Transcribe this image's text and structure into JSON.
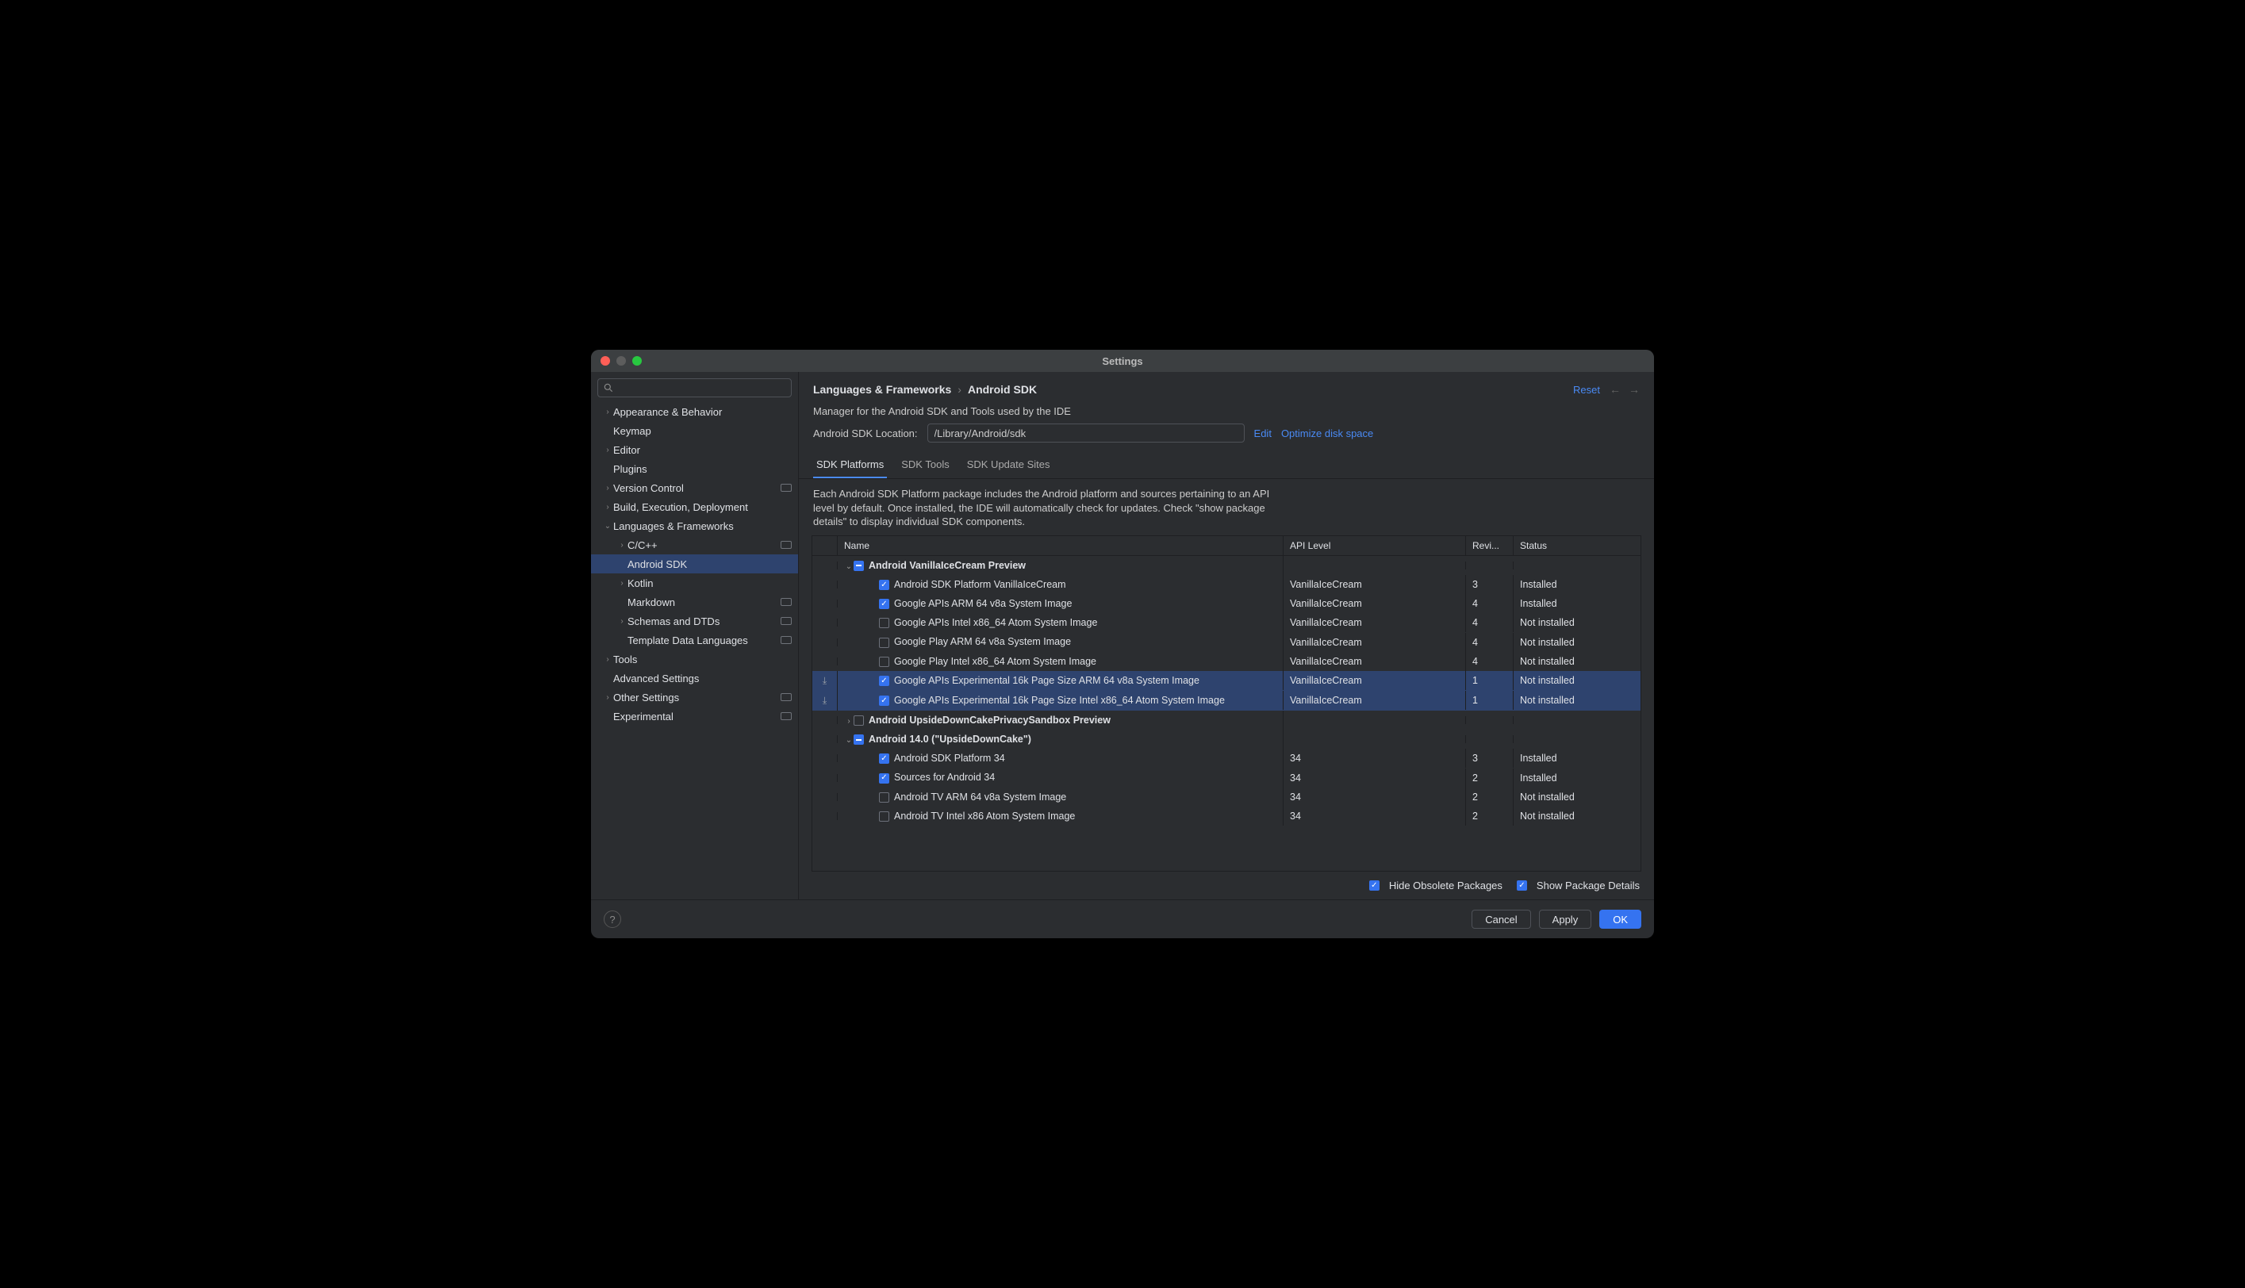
{
  "window": {
    "title": "Settings"
  },
  "search": {
    "placeholder": ""
  },
  "sidebar": {
    "items": [
      {
        "label": "Appearance & Behavior",
        "indent": 0,
        "arrow": "right",
        "pill": false
      },
      {
        "label": "Keymap",
        "indent": 0,
        "arrow": "",
        "pill": false
      },
      {
        "label": "Editor",
        "indent": 0,
        "arrow": "right",
        "pill": false
      },
      {
        "label": "Plugins",
        "indent": 0,
        "arrow": "",
        "pill": false
      },
      {
        "label": "Version Control",
        "indent": 0,
        "arrow": "right",
        "pill": true
      },
      {
        "label": "Build, Execution, Deployment",
        "indent": 0,
        "arrow": "right",
        "pill": false
      },
      {
        "label": "Languages & Frameworks",
        "indent": 0,
        "arrow": "down",
        "pill": false
      },
      {
        "label": "C/C++",
        "indent": 1,
        "arrow": "right",
        "pill": true
      },
      {
        "label": "Android SDK",
        "indent": 1,
        "arrow": "",
        "pill": false,
        "selected": true
      },
      {
        "label": "Kotlin",
        "indent": 1,
        "arrow": "right",
        "pill": false
      },
      {
        "label": "Markdown",
        "indent": 1,
        "arrow": "",
        "pill": true
      },
      {
        "label": "Schemas and DTDs",
        "indent": 1,
        "arrow": "right",
        "pill": true
      },
      {
        "label": "Template Data Languages",
        "indent": 1,
        "arrow": "",
        "pill": true
      },
      {
        "label": "Tools",
        "indent": 0,
        "arrow": "right",
        "pill": false
      },
      {
        "label": "Advanced Settings",
        "indent": 0,
        "arrow": "",
        "pill": false
      },
      {
        "label": "Other Settings",
        "indent": 0,
        "arrow": "right",
        "pill": true
      },
      {
        "label": "Experimental",
        "indent": 0,
        "arrow": "",
        "pill": true
      }
    ]
  },
  "header": {
    "crumb1": "Languages & Frameworks",
    "crumb2": "Android SDK",
    "reset": "Reset"
  },
  "main": {
    "subtitle": "Manager for the Android SDK and Tools used by the IDE",
    "loc_label": "Android SDK Location:",
    "loc_value": "/Library/Android/sdk",
    "edit": "Edit",
    "optimize": "Optimize disk space",
    "tabs": [
      "SDK Platforms",
      "SDK Tools",
      "SDK Update Sites"
    ],
    "desc": "Each Android SDK Platform package includes the Android platform and sources pertaining to an API level by default. Once installed, the IDE will automatically check for updates. Check \"show package details\" to display individual SDK components.",
    "cols": {
      "name": "Name",
      "api": "API Level",
      "rev": "Revi...",
      "status": "Status"
    }
  },
  "rows": [
    {
      "type": "group",
      "expand": "down",
      "chk": "indet",
      "bold": true,
      "name": "Android VanillaIceCream Preview"
    },
    {
      "type": "item",
      "chk": "checked",
      "name": "Android SDK Platform VanillaIceCream",
      "api": "VanillaIceCream",
      "rev": "3",
      "status": "Installed"
    },
    {
      "type": "item",
      "chk": "checked",
      "name": "Google APIs ARM 64 v8a System Image",
      "api": "VanillaIceCream",
      "rev": "4",
      "status": "Installed"
    },
    {
      "type": "item",
      "chk": "",
      "name": "Google APIs Intel x86_64 Atom System Image",
      "api": "VanillaIceCream",
      "rev": "4",
      "status": "Not installed"
    },
    {
      "type": "item",
      "chk": "",
      "name": "Google Play ARM 64 v8a System Image",
      "api": "VanillaIceCream",
      "rev": "4",
      "status": "Not installed"
    },
    {
      "type": "item",
      "chk": "",
      "name": "Google Play Intel x86_64 Atom System Image",
      "api": "VanillaIceCream",
      "rev": "4",
      "status": "Not installed"
    },
    {
      "type": "item",
      "sel": true,
      "dl": true,
      "chk": "checked",
      "name": "Google APIs Experimental 16k Page Size ARM 64 v8a System Image",
      "api": "VanillaIceCream",
      "rev": "1",
      "status": "Not installed"
    },
    {
      "type": "item",
      "sel": true,
      "dl": true,
      "chk": "checked",
      "name": "Google APIs Experimental 16k Page Size Intel x86_64 Atom System Image",
      "api": "VanillaIceCream",
      "rev": "1",
      "status": "Not installed"
    },
    {
      "type": "group",
      "expand": "right",
      "chk": "",
      "bold": true,
      "name": "Android UpsideDownCakePrivacySandbox Preview"
    },
    {
      "type": "group",
      "expand": "down",
      "chk": "indet",
      "bold": true,
      "name": "Android 14.0 (\"UpsideDownCake\")"
    },
    {
      "type": "item",
      "chk": "checked",
      "name": "Android SDK Platform 34",
      "api": "34",
      "rev": "3",
      "status": "Installed"
    },
    {
      "type": "item",
      "chk": "checked",
      "name": "Sources for Android 34",
      "api": "34",
      "rev": "2",
      "status": "Installed"
    },
    {
      "type": "item",
      "chk": "",
      "name": "Android TV ARM 64 v8a System Image",
      "api": "34",
      "rev": "2",
      "status": "Not installed"
    },
    {
      "type": "item",
      "chk": "",
      "name": "Android TV Intel x86 Atom System Image",
      "api": "34",
      "rev": "2",
      "status": "Not installed"
    }
  ],
  "options": {
    "hide": "Hide Obsolete Packages",
    "details": "Show Package Details"
  },
  "footer": {
    "cancel": "Cancel",
    "apply": "Apply",
    "ok": "OK"
  }
}
